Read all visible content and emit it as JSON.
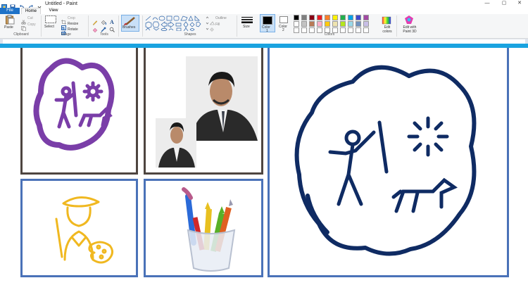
{
  "window": {
    "title": "Untitled - Paint",
    "minimize": "—",
    "restore": "▢",
    "close": "✕"
  },
  "tabs": [
    {
      "label": "File"
    },
    {
      "label": "Home"
    },
    {
      "label": "View"
    }
  ],
  "clipboard": {
    "paste": "Paste",
    "cut": "Cut",
    "copy": "Copy",
    "group": "Clipboard"
  },
  "image": {
    "select": "Select",
    "crop": "Crop",
    "resize": "Resize",
    "rotate": "Rotate",
    "group": "Image"
  },
  "tools": {
    "group": "Tools"
  },
  "brushes": {
    "label": "Brushes"
  },
  "shapes": {
    "outline": "Outline",
    "fill": "Fill",
    "group": "Shapes"
  },
  "size": {
    "label": "Size"
  },
  "color1": {
    "label": "Color",
    "num": "1",
    "value": "#000000"
  },
  "color2": {
    "label": "Color",
    "num": "2",
    "value": "#ffffff"
  },
  "colors": {
    "group": "Colors",
    "palette_row1": [
      "#000000",
      "#7f7f7f",
      "#880015",
      "#ed1c24",
      "#ff7f27",
      "#fff200",
      "#22b14c",
      "#00a2e8",
      "#3f48cc",
      "#a349a4"
    ],
    "palette_row2": [
      "#ffffff",
      "#c3c3c3",
      "#b97a57",
      "#ffaec9",
      "#ffc90e",
      "#efe4b0",
      "#b5e61d",
      "#99d9ea",
      "#7092be",
      "#c8bfe7"
    ],
    "palette_row3": [
      "#ffffff",
      "#ffffff",
      "#ffffff",
      "#ffffff",
      "#ffffff",
      "#ffffff",
      "#ffffff",
      "#ffffff",
      "#ffffff",
      "#ffffff"
    ],
    "edit": "Edit colors",
    "edit3d": "Edit with Paint 3D"
  },
  "accent": "#1aa3e0",
  "panel_colors": {
    "dark": "#4e4540",
    "blue": "#4a72b8"
  }
}
